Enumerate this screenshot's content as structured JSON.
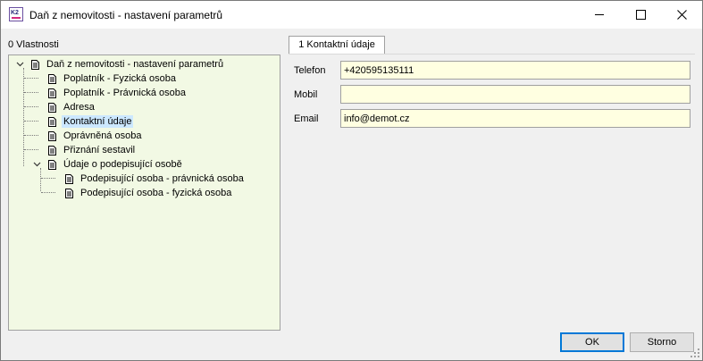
{
  "window": {
    "title": "Daň z nemovitosti - nastavení parametrů",
    "app_icon_text": "K2"
  },
  "left_panel": {
    "label": "0 Vlastnosti"
  },
  "tree": {
    "root": "Daň z nemovitosti - nastavení parametrů",
    "items": [
      {
        "label": "Poplatník - Fyzická osoba"
      },
      {
        "label": "Poplatník - Právnická osoba"
      },
      {
        "label": "Adresa"
      },
      {
        "label": "Kontaktní údaje"
      },
      {
        "label": "Oprávněná osoba"
      },
      {
        "label": "Přiznání sestavil"
      },
      {
        "label": "Údaje o podepisující osobě"
      }
    ],
    "subitems": [
      {
        "label": "Podepisující osoba - právnická osoba"
      },
      {
        "label": "Podepisující osoba - fyzická osoba"
      }
    ],
    "selected": "Kontaktní údaje"
  },
  "tab": {
    "label": "1 Kontaktní údaje"
  },
  "form": {
    "phone_label": "Telefon",
    "phone_value": "+420595135111",
    "mobile_label": "Mobil",
    "mobile_value": "",
    "email_label": "Email",
    "email_value": "info@demot.cz"
  },
  "buttons": {
    "ok": "OK",
    "cancel": "Storno"
  },
  "colors": {
    "tree_bg": "#f2f9e4",
    "field_bg": "#ffffe1",
    "selection": "#cce8ff",
    "default_button_border": "#0078d7"
  }
}
